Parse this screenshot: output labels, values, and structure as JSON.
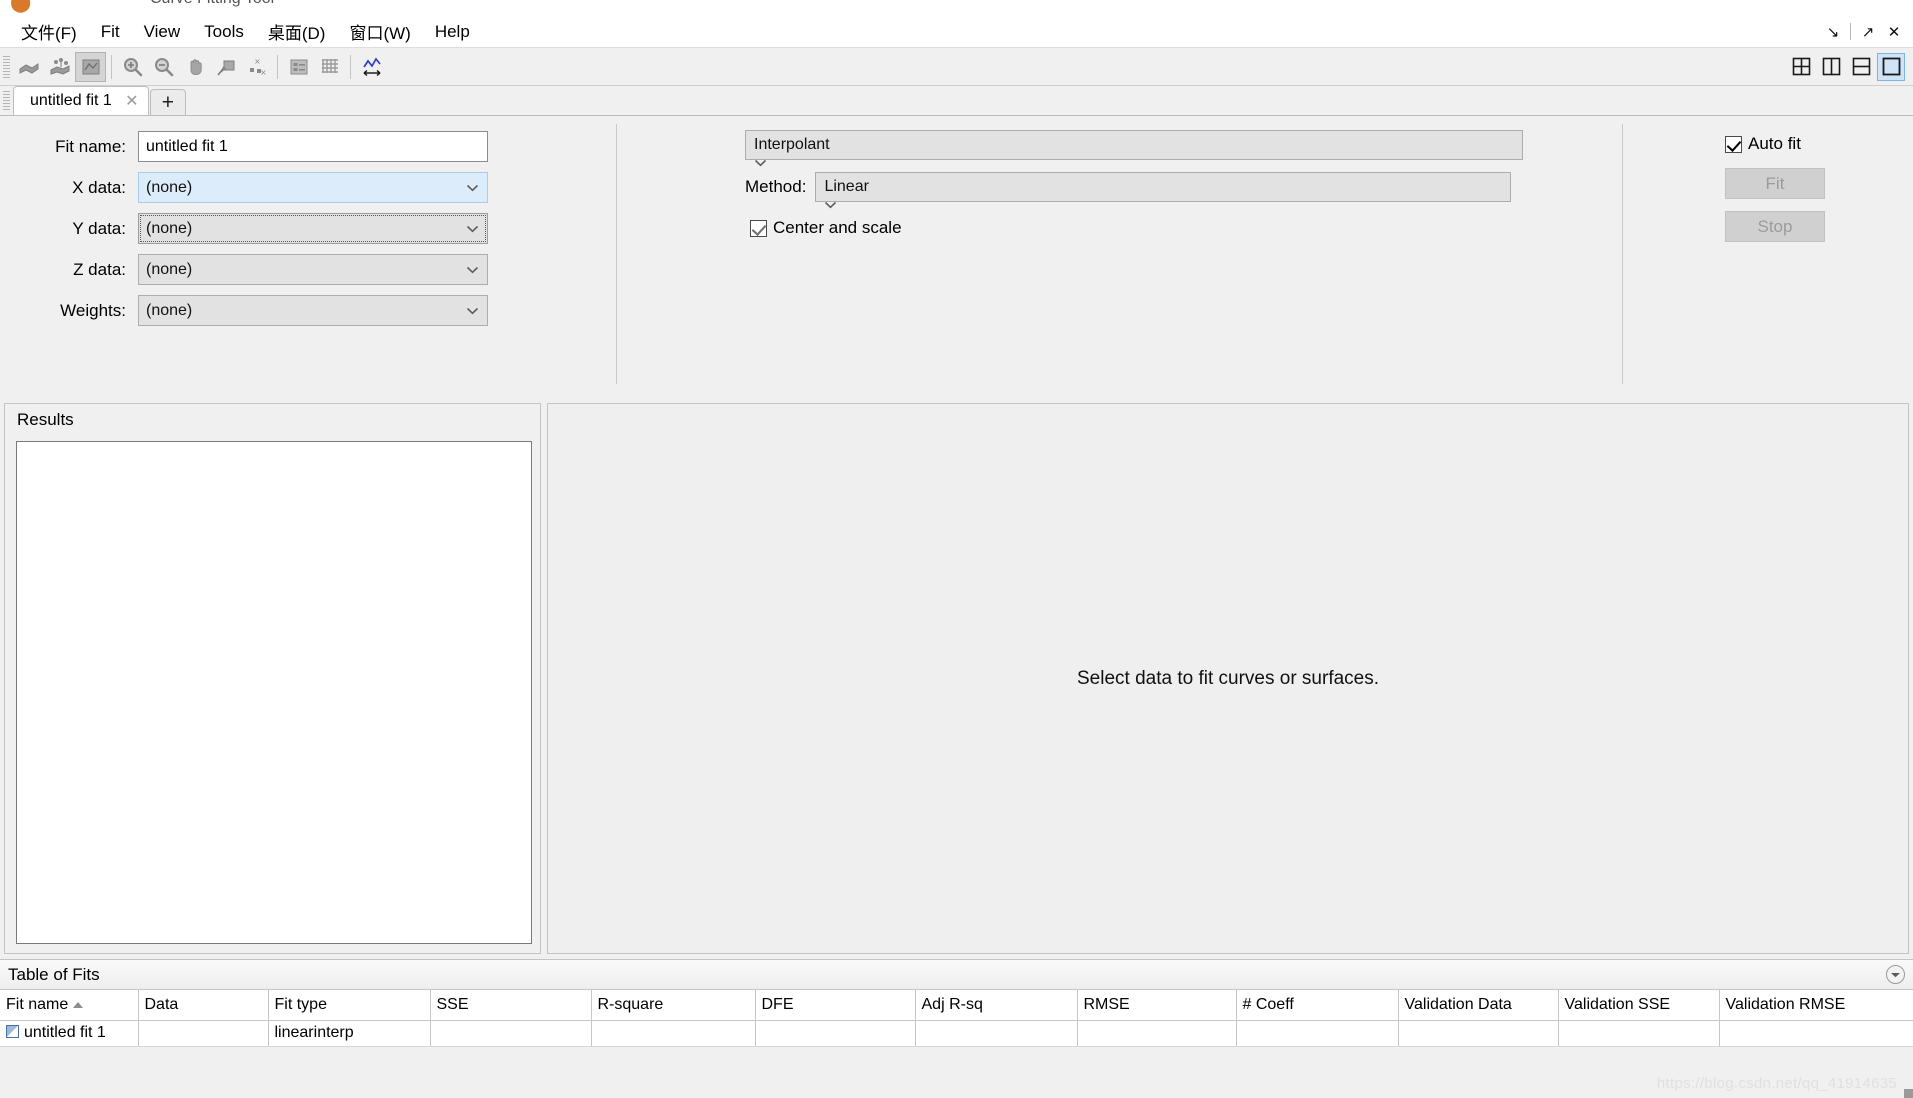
{
  "window": {
    "title": "Curve Fitting Tool",
    "controls": [
      {
        "name": "minimize-panel",
        "glyph": "↘"
      },
      {
        "name": "undock-panel",
        "glyph": "↗"
      },
      {
        "name": "close-window",
        "glyph": "✕"
      }
    ]
  },
  "menubar": {
    "items": [
      {
        "name": "file",
        "label": "文件(F)"
      },
      {
        "name": "fit",
        "label": "Fit"
      },
      {
        "name": "view",
        "label": "View"
      },
      {
        "name": "tools",
        "label": "Tools"
      },
      {
        "name": "desktop",
        "label": "桌面(D)"
      },
      {
        "name": "window",
        "label": "窗口(W)"
      },
      {
        "name": "help",
        "label": "Help"
      }
    ]
  },
  "toolbar": {
    "buttons": [
      {
        "name": "fit-surface-icon",
        "tooltip": "Fit surface"
      },
      {
        "name": "fit-surface-points-icon",
        "tooltip": "Fit surface with points"
      },
      {
        "name": "residuals-plot-icon",
        "tooltip": "Residuals plot"
      },
      {
        "name": "zoom-in-icon",
        "tooltip": "Zoom In"
      },
      {
        "name": "zoom-out-icon",
        "tooltip": "Zoom Out"
      },
      {
        "name": "pan-icon",
        "tooltip": "Pan"
      },
      {
        "name": "data-cursor-icon",
        "tooltip": "Data Cursor"
      },
      {
        "name": "exclude-outliers-icon",
        "tooltip": "Exclude outliers"
      },
      {
        "name": "legend-icon",
        "tooltip": "Legend"
      },
      {
        "name": "grid-icon",
        "tooltip": "Grid"
      },
      {
        "name": "axes-limits-icon",
        "tooltip": "Axes limits"
      }
    ],
    "layout_buttons": [
      {
        "name": "layout-quad",
        "tooltip": "Four panels"
      },
      {
        "name": "layout-vertical-split",
        "tooltip": "Side by side"
      },
      {
        "name": "layout-horizontal-split",
        "tooltip": "Stacked"
      },
      {
        "name": "layout-single",
        "tooltip": "Single panel",
        "selected": true
      }
    ]
  },
  "tabs": {
    "items": [
      {
        "name": "tab-untitled-fit-1",
        "label": "untitled fit 1",
        "active": true,
        "close_glyph": "✕"
      }
    ],
    "add_label": "+"
  },
  "fit_config": {
    "fit_name": {
      "label": "Fit name:",
      "value": "untitled fit 1",
      "placeholder": "Fit name"
    },
    "x_data": {
      "label": "X data:",
      "value": "(none)",
      "state": "hover"
    },
    "y_data": {
      "label": "Y data:",
      "value": "(none)",
      "state": "focus"
    },
    "z_data": {
      "label": "Z data:",
      "value": "(none)",
      "state": "normal"
    },
    "weights": {
      "label": "Weights:",
      "value": "(none)",
      "state": "normal"
    },
    "fit_type": {
      "value": "Interpolant"
    },
    "method": {
      "label": "Method:",
      "value": "Linear"
    },
    "center_and_scale": {
      "label": "Center and scale",
      "checked": true
    },
    "auto_fit": {
      "label": "Auto fit",
      "checked": true
    },
    "fit_button": {
      "label": "Fit",
      "enabled": false
    },
    "stop_button": {
      "label": "Stop",
      "enabled": false
    }
  },
  "results": {
    "title": "Results",
    "content": ""
  },
  "plot": {
    "message": "Select data to fit curves or surfaces."
  },
  "table_of_fits": {
    "title": "Table of Fits",
    "sort_column": "Fit name",
    "sort_direction": "asc",
    "columns": [
      "Fit name",
      "Data",
      "Fit type",
      "SSE",
      "R-square",
      "DFE",
      "Adj R-sq",
      "RMSE",
      "# Coeff",
      "Validation Data",
      "Validation SSE",
      "Validation RMSE"
    ],
    "rows": [
      {
        "fit_name": "untitled fit 1",
        "data": "",
        "fit_type": "linearinterp",
        "sse": "",
        "r_square": "",
        "dfe": "",
        "adj_r_sq": "",
        "rmse": "",
        "num_coeff": "",
        "validation_data": "",
        "validation_sse": "",
        "validation_rmse": ""
      }
    ]
  },
  "watermark": "https://blog.csdn.net/qq_41914635",
  "colors": {
    "window_bg": "#f0f0f0",
    "panel_bg": "#efefef",
    "field_bg": "#ffffff",
    "combo_bg": "#e2e2e2",
    "hover_blue": "#dcecfb",
    "selected_blue": "#cfe4f7",
    "border": "#c4c4c4",
    "text": "#000000",
    "disabled_text": "#9b9b9b",
    "accent_line": "#2f3cc4"
  }
}
